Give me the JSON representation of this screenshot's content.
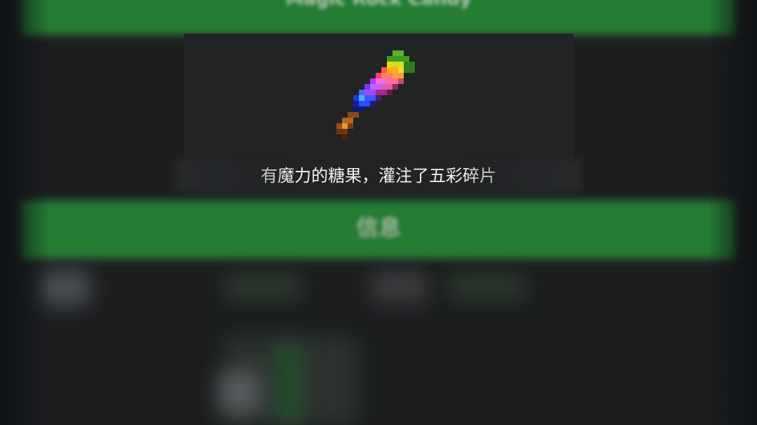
{
  "item": {
    "title": "Magic Rock Candy",
    "icon": "rock-candy-sprite-icon",
    "description": "有魔力的糖果，灌注了五彩碎片"
  },
  "sections": {
    "info_title": "信息"
  },
  "colors": {
    "accent_green": "#257c33",
    "background": "#1c1e20",
    "panel": "#212325",
    "text": "#f2f2f2"
  }
}
